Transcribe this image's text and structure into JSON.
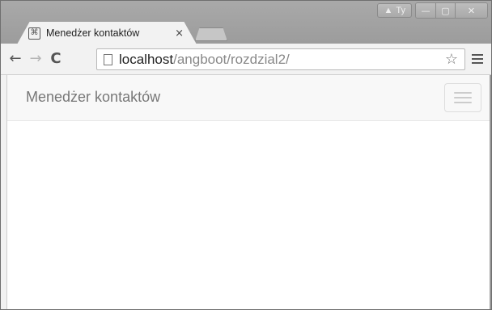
{
  "browser": {
    "tab": {
      "title": "Menedżer kontaktów",
      "close_glyph": "×",
      "favicon_glyph": "⌘"
    },
    "window_controls": {
      "user_label": "Ty",
      "warning_glyph": "▲",
      "minimize_glyph": "—",
      "maximize_glyph": "▢",
      "close_glyph": "✕"
    },
    "toolbar": {
      "back_glyph": "←",
      "forward_glyph": "→",
      "reload_glyph": "C",
      "url_host": "localhost",
      "url_path": "/angboot/rozdzial2/",
      "star_glyph": "☆"
    }
  },
  "page": {
    "navbar": {
      "brand": "Menedżer kontaktów"
    }
  },
  "colors": {
    "chrome_frame": "#9c9c9c",
    "tab_bg": "#f2f2f2",
    "navbar_bg": "#f8f8f8",
    "brand_text": "#777777"
  }
}
